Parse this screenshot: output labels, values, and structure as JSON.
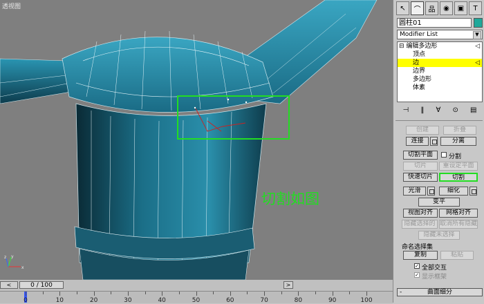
{
  "viewport": {
    "label": "透视图",
    "annotation": "切割如图",
    "axis": {
      "x": "x",
      "y": "y",
      "z": "z"
    }
  },
  "toolbar": {
    "icons": [
      "arrow-icon",
      "bend-icon",
      "hierarchy-icon",
      "motion-icon",
      "display-icon",
      "utilities-icon"
    ]
  },
  "object": {
    "name": "圆柱01",
    "color": "#1fa89a"
  },
  "modifier_list": {
    "label": "Modifier List"
  },
  "stack": {
    "root": "编辑多边形",
    "items": [
      {
        "label": "顶点"
      },
      {
        "label": "边"
      },
      {
        "label": "边界"
      },
      {
        "label": "多边形"
      },
      {
        "label": "体素"
      }
    ]
  },
  "edit_geometry": {
    "top_left": "创建",
    "top_right": "折叠",
    "attach": "连接",
    "detach": "分离",
    "slice_plane": "切割平面",
    "split": "分割",
    "slice": "切片",
    "reset_plane": "重设定平面",
    "quickslice": "快速切片",
    "cut": "切割",
    "meshsmooth": "光滑",
    "tessellate": "细化",
    "make_planar": "变平",
    "view_align": "视图对齐",
    "grid_align": "网格对齐",
    "hide_selected": "隐藏选择的",
    "unhide_all": "取消所有隐藏",
    "hide_unselected": "隐藏未选择",
    "named_selections": "命名选择集",
    "copy": "复制",
    "paste": "粘贴",
    "full_interactivity": "全部交互",
    "show_cage": "显示框架"
  },
  "subdivision": {
    "label": "曲面细分",
    "collapse": "-"
  },
  "timeline": {
    "frame": "0 / 100",
    "ticks": [
      "0",
      "10",
      "20",
      "30",
      "40",
      "50",
      "60",
      "70",
      "80",
      "90",
      "100"
    ]
  }
}
